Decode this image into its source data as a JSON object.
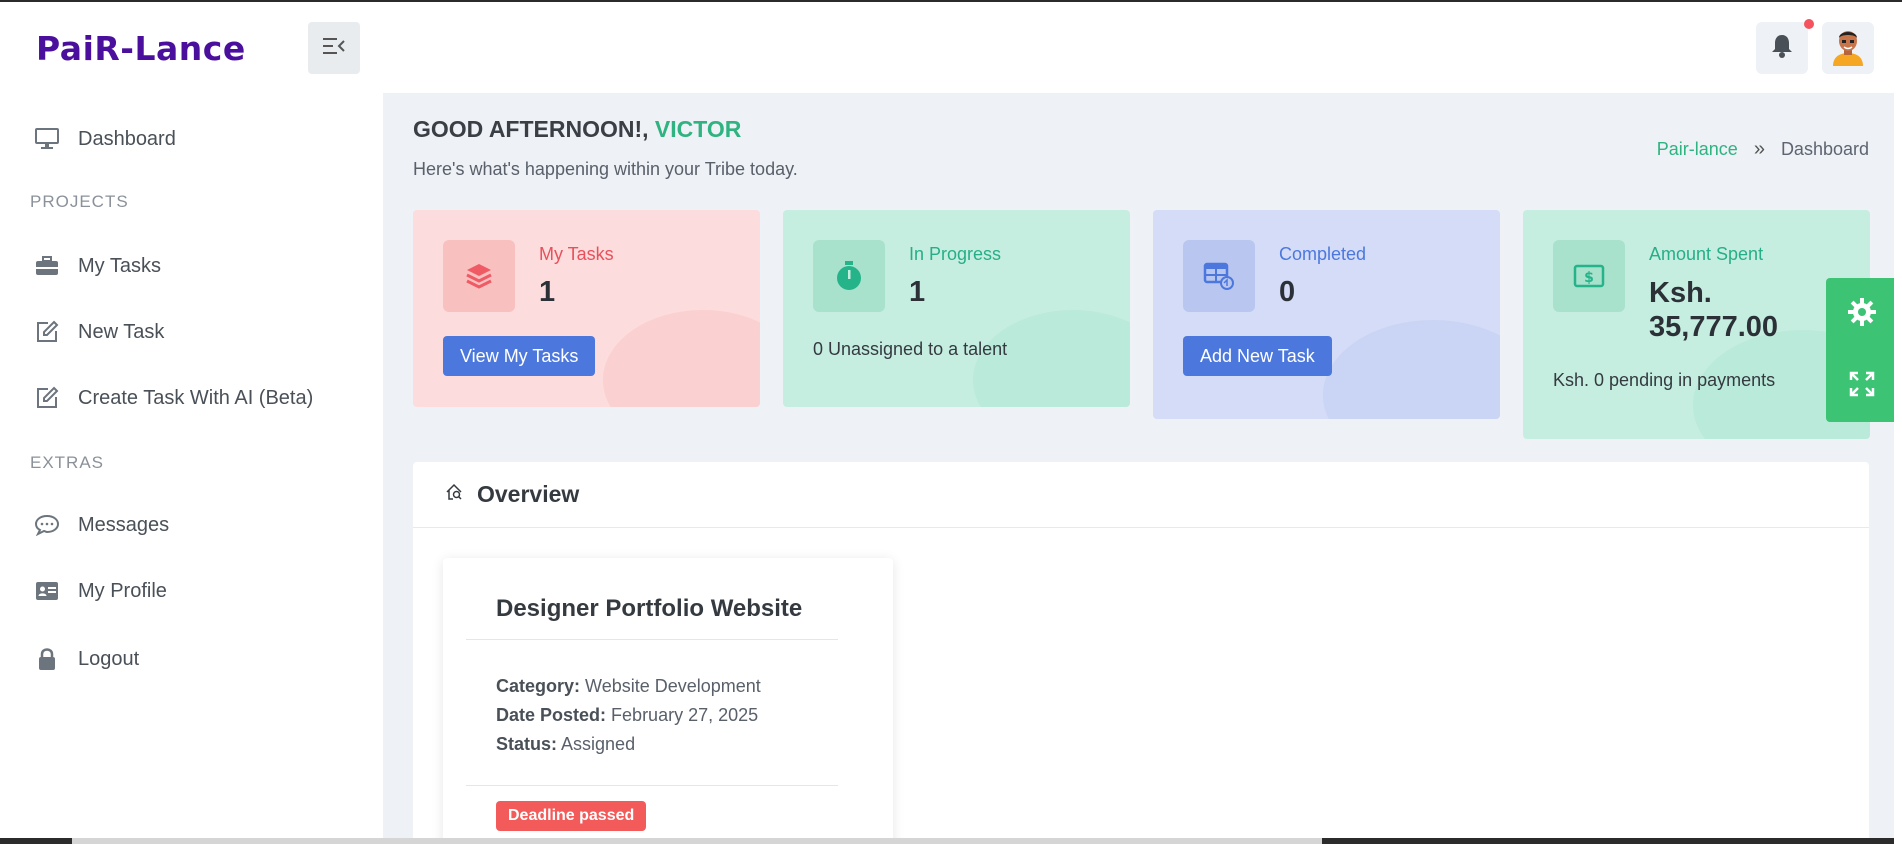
{
  "header": {
    "logo_text": "PaiR-Lance",
    "menu_toggle_icon": "menu-collapse-icon",
    "bell_icon": "bell-icon",
    "notification_dot_color": "#f4525d",
    "avatar_icon": "avatar"
  },
  "sidebar": {
    "dashboard": "Dashboard",
    "heading_projects": "PROJECTS",
    "my_tasks": "My Tasks",
    "new_task": "New Task",
    "create_ai": "Create Task With AI (Beta)",
    "heading_extras": "EXTRAS",
    "messages": "Messages",
    "my_profile": "My Profile",
    "logout": "Logout"
  },
  "main": {
    "greeting_prefix": "GOOD AFTERNOON!,",
    "greeting_name": "VICTOR",
    "subtitle": "Here's what's happening within your Tribe today.",
    "breadcrumb": {
      "home": "Pair-lance",
      "sep": "»",
      "current": "Dashboard"
    },
    "cards": {
      "tasks": {
        "title": "My Tasks",
        "value": "1",
        "button": "View My Tasks"
      },
      "progress": {
        "title": "In Progress",
        "value": "1",
        "note": "0 Unassigned to a talent"
      },
      "completed": {
        "title": "Completed",
        "value": "0",
        "button": "Add New Task"
      },
      "amount": {
        "title": "Amount Spent",
        "value_line1": "Ksh.",
        "value_line2": "35,777.00",
        "note": "Ksh. 0 pending in payments"
      }
    },
    "overview": {
      "title": "Overview",
      "task": {
        "title": "Designer Portfolio Website",
        "category_label": "Category:",
        "category_value": "Website Development",
        "date_label": "Date Posted:",
        "date_value": "February 27, 2025",
        "status_label": "Status:",
        "status_value": "Assigned",
        "badge": "Deadline passed"
      }
    }
  },
  "colors": {
    "accent_green": "#2fb380",
    "primary_blue": "#4c78dd",
    "danger_red": "#f35a5a",
    "brand_purple": "#4b0f9e"
  }
}
